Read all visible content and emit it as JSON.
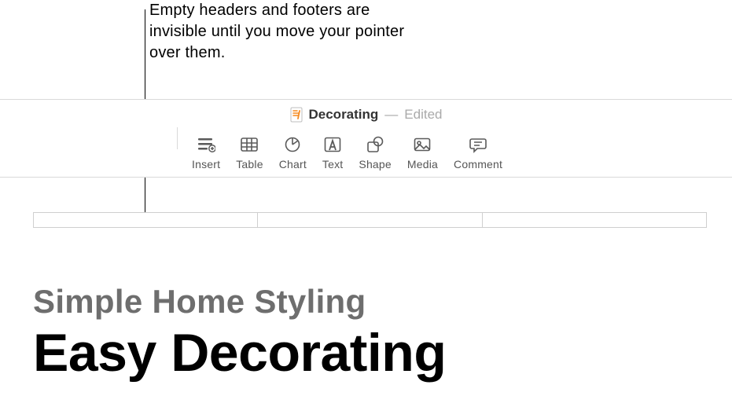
{
  "callout": {
    "text": "Empty headers and footers are invisible until you move your pointer over them."
  },
  "titlebar": {
    "docname": "Decorating",
    "separator": "—",
    "status": "Edited"
  },
  "toolbar": {
    "insert": "Insert",
    "table": "Table",
    "chart": "Chart",
    "text": "Text",
    "shape": "Shape",
    "media": "Media",
    "comment": "Comment"
  },
  "document": {
    "subtitle": "Simple Home Styling",
    "title": "Easy Decorating"
  }
}
